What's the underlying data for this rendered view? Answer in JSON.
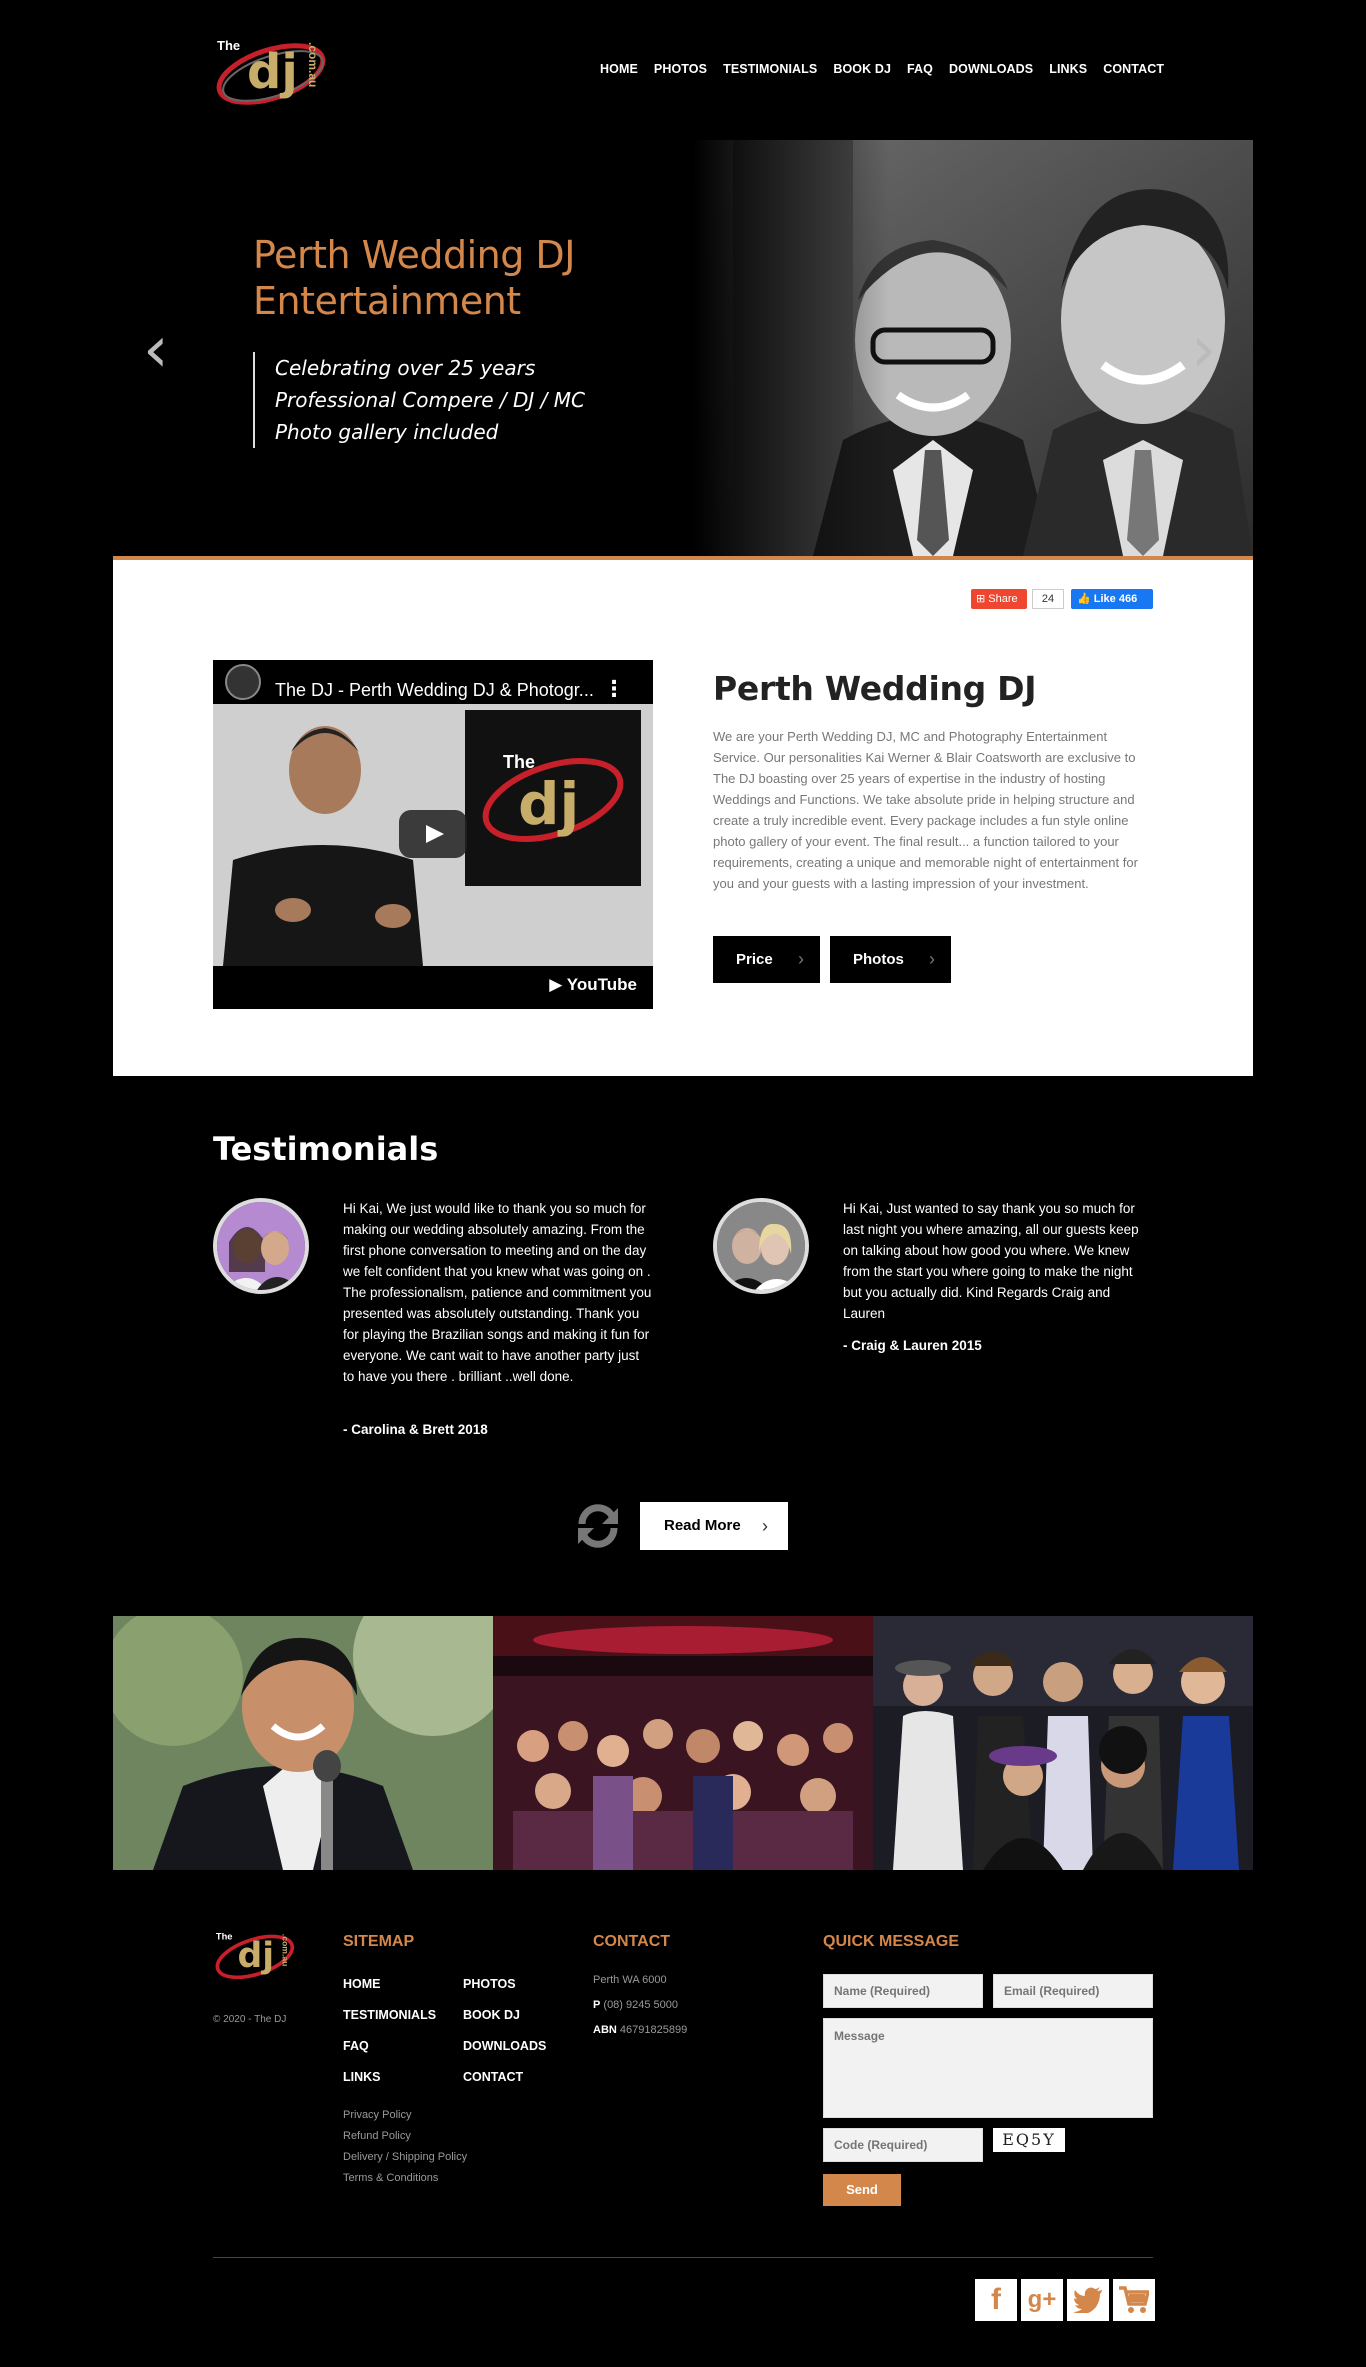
{
  "nav": {
    "items": [
      "HOME",
      "PHOTOS",
      "TESTIMONIALS",
      "BOOK DJ",
      "FAQ",
      "DOWNLOADS",
      "LINKS",
      "CONTACT"
    ]
  },
  "hero": {
    "title": "Perth Wedding DJ Entertainment",
    "lines": [
      "Celebrating over 25 years",
      "Professional Compere / DJ / MC",
      "Photo gallery included"
    ]
  },
  "social_bar": {
    "share_label": "Share",
    "share_count": "24",
    "like_label": "Like 466"
  },
  "video": {
    "title": "The DJ - Perth Wedding DJ & Photogr...",
    "brand": "YouTube"
  },
  "intro": {
    "heading": "Perth Wedding DJ",
    "body": "We are your Perth Wedding DJ, MC and Photography Entertainment Service. Our personalities Kai Werner & Blair Coatsworth are exclusive to The DJ boasting over 25 years of expertise in the industry of hosting Weddings and Functions. We take absolute pride in helping structure and create a truly incredible event. Every package includes a fun style online photo gallery of your event. The final result... a function tailored to your requirements, creating a unique and memorable night of entertainment for you and your guests with a lasting impression of your investment.",
    "price_label": "Price",
    "photos_label": "Photos"
  },
  "testimonials": {
    "heading": "Testimonials",
    "items": [
      {
        "text": "Hi Kai, We just would like to thank you so much for making our wedding absolutely amazing. From the first phone conversation to meeting and on the day we felt confident that you knew what was going on . The professionalism, patience and commitment you presented was absolutely outstanding. Thank you for playing the Brazilian songs and making it fun for everyone. We cant wait to have another party just to have you there . brilliant ..well done.",
        "author": "- Carolina & Brett 2018"
      },
      {
        "text": "Hi Kai, Just wanted to say thank you so much for last night you where amazing, all our guests keep on talking about how good you where. We knew from the start you where going to make the night but you actually did. Kind Regards Craig and Lauren",
        "author": "- Craig & Lauren 2015"
      }
    ],
    "read_more_label": "Read More"
  },
  "footer": {
    "copyright": "© 2020 - The DJ",
    "sitemap_heading": "SITEMAP",
    "sitemap_left": [
      "HOME",
      "TESTIMONIALS",
      "FAQ",
      "LINKS"
    ],
    "sitemap_right": [
      "PHOTOS",
      "BOOK DJ",
      "DOWNLOADS",
      "CONTACT"
    ],
    "policies": [
      "Privacy Policy",
      "Refund Policy",
      "Delivery / Shipping Policy",
      "Terms & Conditions"
    ],
    "contact_heading": "CONTACT",
    "address": "Perth WA 6000",
    "phone_label": "P",
    "phone": "(08) 9245 5000",
    "abn_label": "ABN",
    "abn": "46791825899",
    "quick_heading": "QUICK MESSAGE",
    "name_placeholder": "Name (Required)",
    "email_placeholder": "Email (Required)",
    "message_placeholder": "Message",
    "code_placeholder": "Code (Required)",
    "captcha": "EQ5Y",
    "send_label": "Send"
  },
  "social_icons": [
    "facebook-icon",
    "google-plus-icon",
    "twitter-icon",
    "cart-icon"
  ],
  "colors": {
    "accent": "#d4874b",
    "background": "#000000",
    "facebook_like": "#1877f2",
    "share": "#ee4630"
  }
}
